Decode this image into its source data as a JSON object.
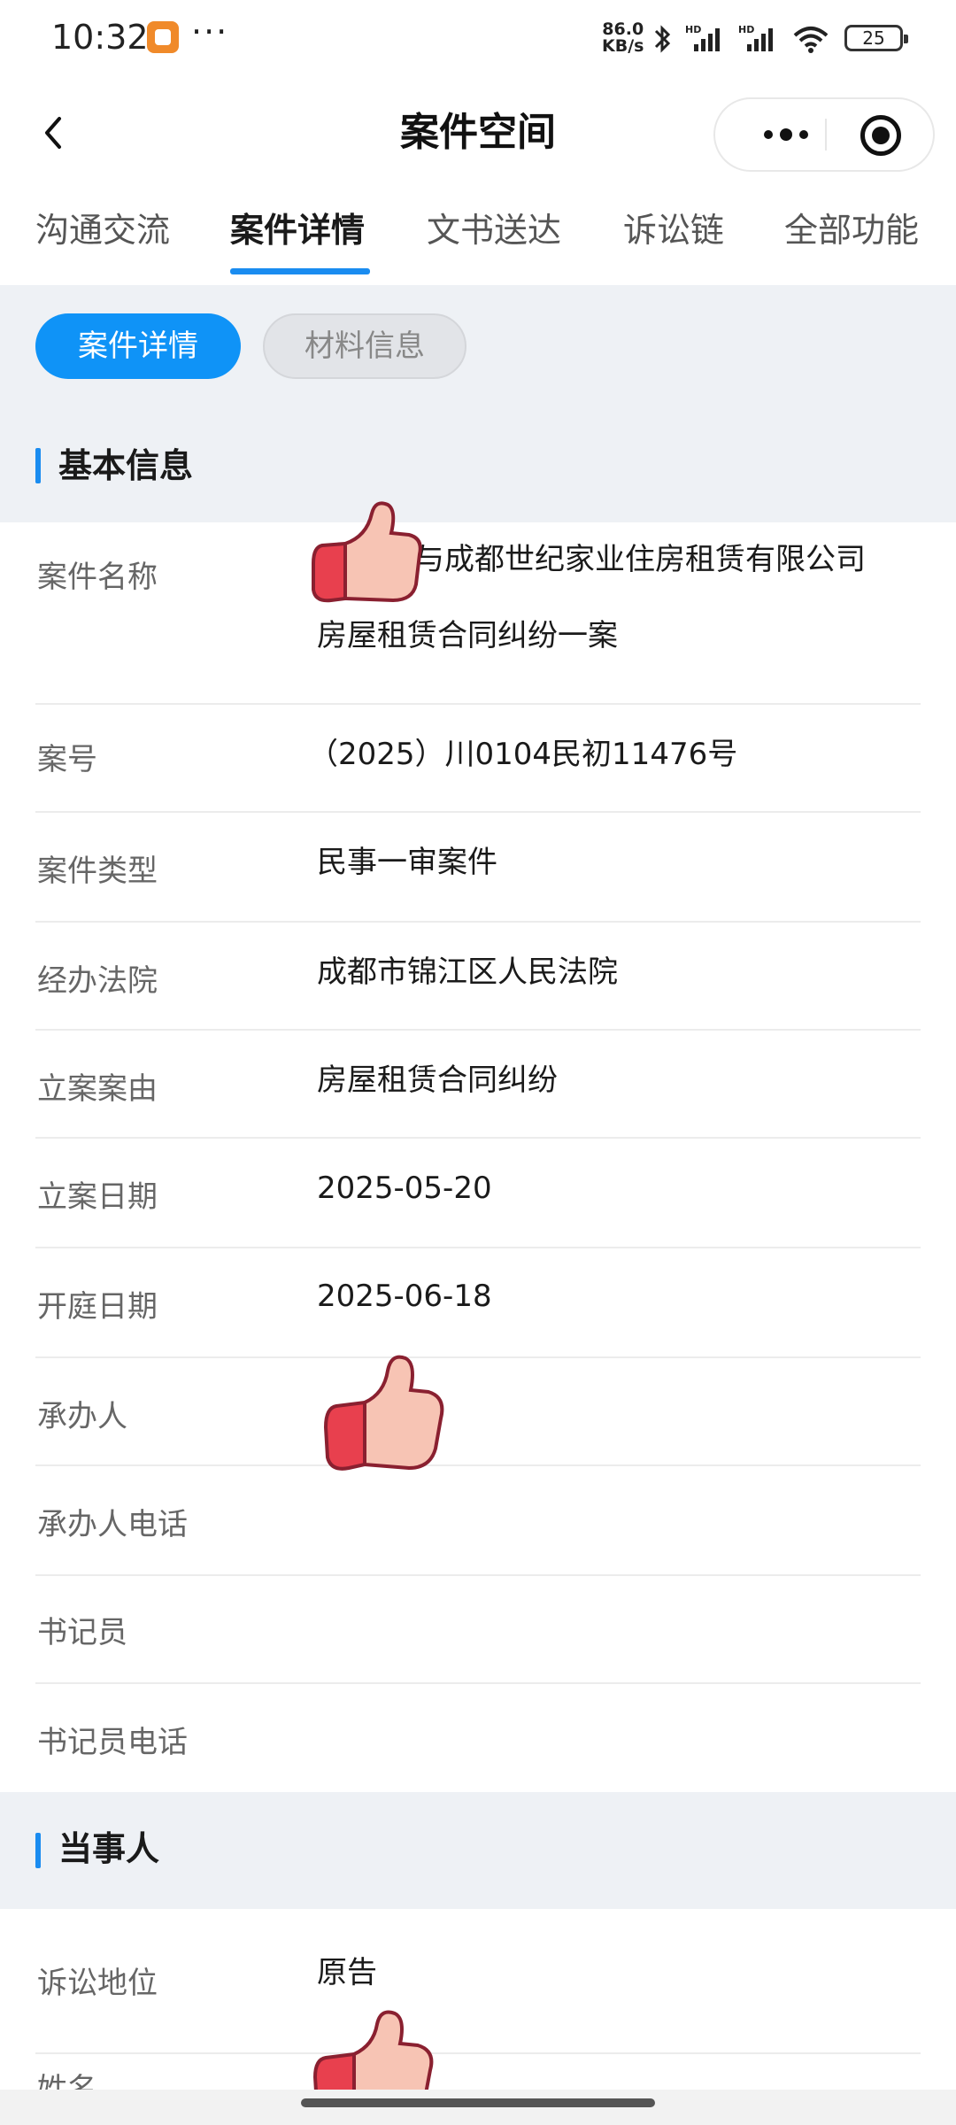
{
  "status_bar": {
    "time": "10:32",
    "more": "···",
    "net_speed_value": "86.0",
    "net_speed_unit": "KB/s",
    "battery": "25",
    "icons": [
      "app-icon",
      "bluetooth-icon",
      "signal-hd-icon",
      "signal-hd-icon",
      "wifi-icon",
      "battery-icon"
    ]
  },
  "header": {
    "title": "案件空间"
  },
  "tabs": [
    {
      "label": "沟通交流",
      "active": false
    },
    {
      "label": "案件详情",
      "active": true
    },
    {
      "label": "文书送达",
      "active": false
    },
    {
      "label": "诉讼链",
      "active": false
    },
    {
      "label": "全部功能",
      "active": false
    }
  ],
  "sub_tabs": [
    {
      "label": "案件详情",
      "active": true
    },
    {
      "label": "材料信息",
      "active": false
    }
  ],
  "basic_info": {
    "title": "基本信息",
    "rows": [
      {
        "label": "案件名称",
        "value": "与成都世纪家业住房租赁有限公司",
        "value2": "房屋租赁合同纠纷一案"
      },
      {
        "label": "案号",
        "value": "（2025）川0104民初11476号"
      },
      {
        "label": "案件类型",
        "value": "民事一审案件"
      },
      {
        "label": "经办法院",
        "value": "成都市锦江区人民法院"
      },
      {
        "label": "立案案由",
        "value": "房屋租赁合同纠纷"
      },
      {
        "label": "立案日期",
        "value": "2025-05-20"
      },
      {
        "label": "开庭日期",
        "value": "2025-06-18"
      },
      {
        "label": "承办人",
        "value": ""
      },
      {
        "label": "承办人电话",
        "value": ""
      },
      {
        "label": "书记员",
        "value": ""
      },
      {
        "label": "书记员电话",
        "value": ""
      }
    ]
  },
  "parties": {
    "title": "当事人",
    "rows": [
      {
        "label": "诉讼地位",
        "value": "原告"
      },
      {
        "label": "姓名",
        "value": ""
      }
    ]
  },
  "colors": {
    "accent": "#1a8cf0",
    "pill_active": "#0f93f7",
    "section_bg": "#eef1f5"
  }
}
